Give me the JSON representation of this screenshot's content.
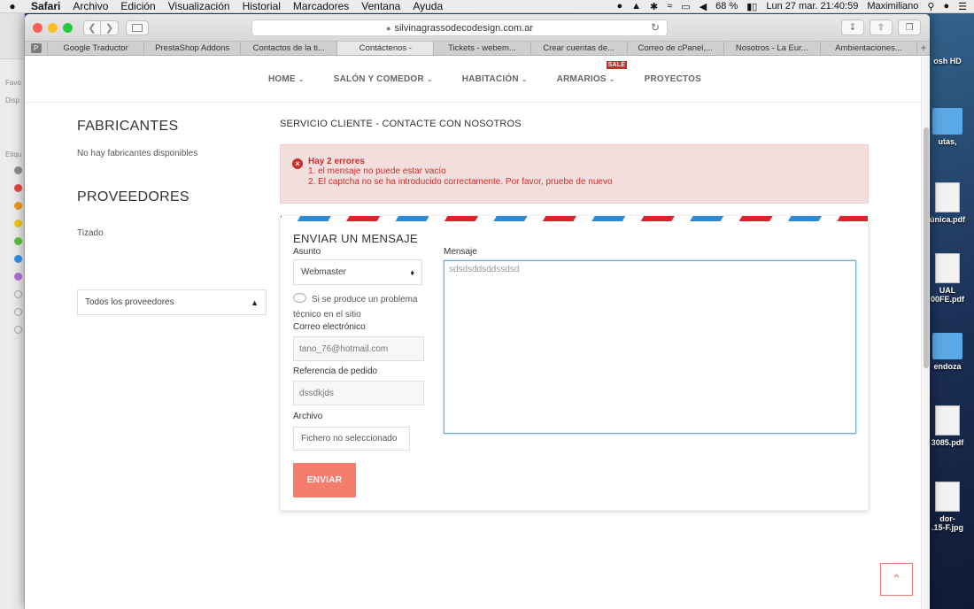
{
  "menubar": {
    "apple": "",
    "items": [
      "Safari",
      "Archivo",
      "Edición",
      "Visualización",
      "Historial",
      "Marcadores",
      "Ventana",
      "Ayuda"
    ],
    "battery": "68 %",
    "clock": "Lun 27 mar. 21:40:59",
    "user": "Maximiliano"
  },
  "browser": {
    "url": "silvinagrassodecodesign.com.ar",
    "pinned_tab": "P",
    "tabs": [
      "Google Traductor",
      "PrestaShop Addons",
      "Contactos de la ti...",
      "Contáctenos -",
      "Tickets - webem...",
      "Crear cuentas de...",
      "Correo de cPanel,...",
      "Nosotros - La Eur...",
      "Ambientaciones..."
    ],
    "active_tab": "Contáctenos -",
    "new_tab": "+"
  },
  "desktop": {
    "items": [
      "osh HD",
      "utas,",
      "única.pdf",
      "UAL",
      "00FE.pdf",
      "endoza",
      "3085.pdf",
      "dor-",
      ".15-F.jpg"
    ]
  },
  "finder": {
    "labels": [
      "Favo",
      "Disp",
      "Etiqu"
    ]
  },
  "site": {
    "nav": {
      "home": "HOME",
      "salon": "SALÓN Y COMEDOR",
      "habitacion": "HABITACIÓN",
      "armarios": "ARMARIOS",
      "sale": "SALE",
      "proyectos": "PROYECTOS"
    },
    "left": {
      "fabricantes_title": "FABRICANTES",
      "fabricantes_text": "No hay fabricantes disponibles",
      "proveedores_title": "PROVEEDORES",
      "proveedor_item": "Tizado",
      "proveedores_select": "Todos los proveedores"
    },
    "main": {
      "title": "SERVICIO CLIENTE - CONTACTE CON NOSOTROS",
      "alert_title": "Hay 2 errores",
      "errors": [
        "1.  el mensaje no puede estar vacío",
        "2.  El captcha no se ha introducido correctamente. Por favor, pruebe de nuevo"
      ],
      "form_title": "ENVIAR UN MENSAJE",
      "subject_label": "Asunto",
      "subject_value": "Webmaster",
      "hint": "Si se produce un problema técnico en el sitio",
      "email_label": "Correo electrónico",
      "email_value": "tano_76@hotmail.com",
      "order_label": "Referencia de pedido",
      "order_value": "dssdkjds",
      "file_label": "Archivo",
      "file_value": "Fichero no seleccionado",
      "message_label": "Mensaje",
      "message_value": "sdsdsddsddssdsd",
      "send_button": "ENVIAR"
    }
  }
}
